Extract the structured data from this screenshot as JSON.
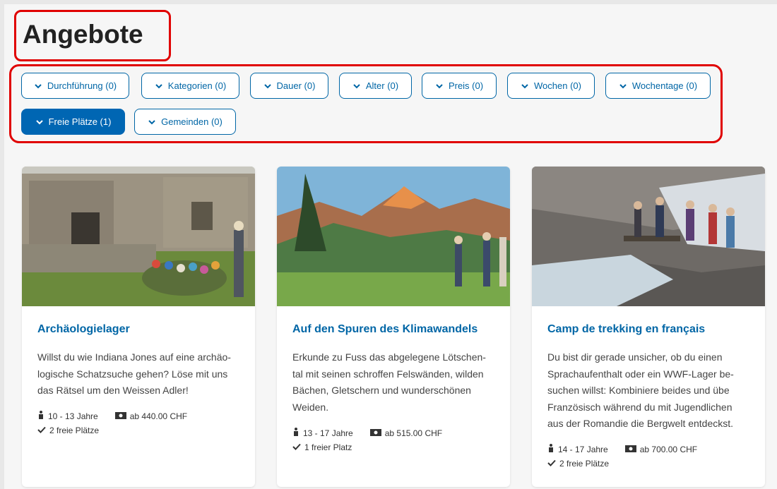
{
  "page": {
    "title": "Angebote"
  },
  "filters": [
    {
      "label": "Durchführung (0)",
      "active": false
    },
    {
      "label": "Kategorien (0)",
      "active": false
    },
    {
      "label": "Dauer (0)",
      "active": false
    },
    {
      "label": "Alter (0)",
      "active": false
    },
    {
      "label": "Preis (0)",
      "active": false
    },
    {
      "label": "Wochen (0)",
      "active": false
    },
    {
      "label": "Wochentage (0)",
      "active": false
    },
    {
      "label": "Freie Plätze (1)",
      "active": true
    },
    {
      "label": "Gemeinden (0)",
      "active": false
    }
  ],
  "cards": [
    {
      "title": "Archäologielager",
      "description": [
        "Willst du wie Indiana Jones auf eine archäo-",
        "logische Schatzsuche gehen? Löse mit uns",
        "das Rätsel um den Weissen Adler!"
      ],
      "age": "10 - 13 Jahre",
      "price": "ab 440.00 CHF",
      "availability": "2 freie Plätze"
    },
    {
      "title": "Auf den Spuren des Klimawandels",
      "description": [
        "Erkunde zu Fuss das abgelegene Lötschen-",
        "tal mit seinen schroffen Felswänden, wilden",
        "Bächen, Gletschern und wunderschönen",
        "Weiden."
      ],
      "age": "13 - 17 Jahre",
      "price": "ab 515.00 CHF",
      "availability": "1 freier Platz"
    },
    {
      "title": "Camp de trekking en français",
      "description": [
        "Du bist dir gerade unsicher, ob du einen",
        "Sprachaufenthalt oder ein WWF-Lager be-",
        "suchen willst: Kombiniere beides und übe",
        "Französisch während du mit Jugendlichen",
        "aus der Romandie die Bergwelt entdeckst."
      ],
      "age": "14 - 17 Jahre",
      "price": "ab 700.00 CHF",
      "availability": "2 freie Plätze"
    }
  ],
  "colors": {
    "accent": "#0066a6",
    "highlight": "#e00000"
  }
}
